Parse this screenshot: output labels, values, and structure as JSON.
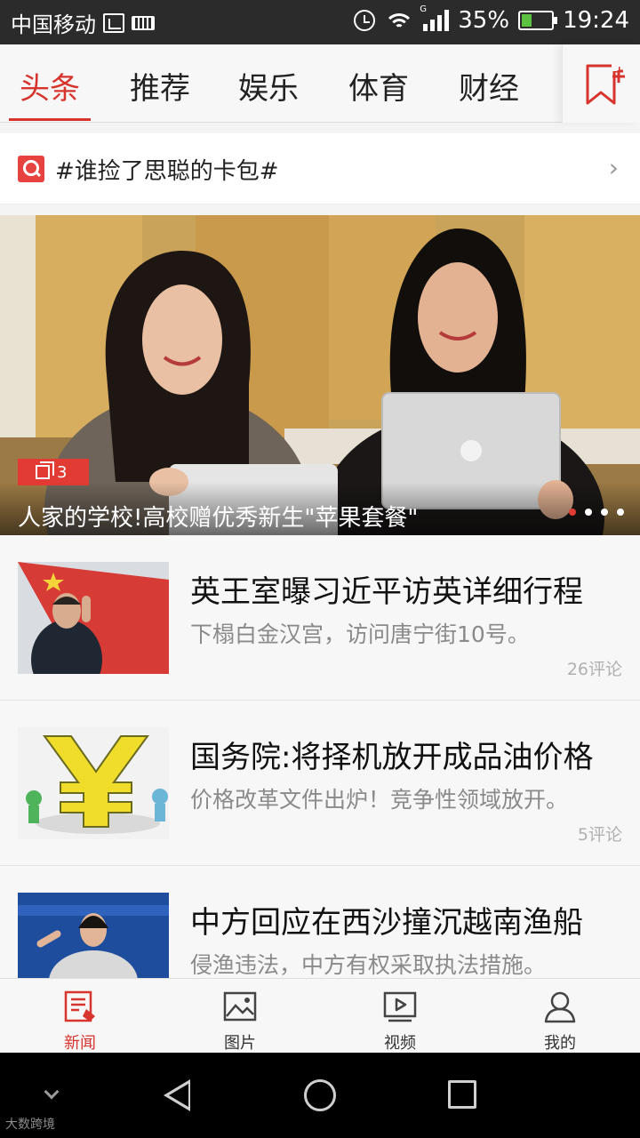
{
  "status_bar": {
    "carrier": "中国移动",
    "network_type": "G",
    "battery": "35%",
    "time": "19:24"
  },
  "tabs": {
    "items": [
      {
        "label": "头条",
        "active": true
      },
      {
        "label": "推荐",
        "active": false
      },
      {
        "label": "娱乐",
        "active": false
      },
      {
        "label": "体育",
        "active": false
      },
      {
        "label": "财经",
        "active": false
      }
    ],
    "add_icon": "bookmark-plus-icon"
  },
  "search": {
    "icon": "search-icon",
    "text": "#谁捡了思聪的卡包#",
    "arrow": "›"
  },
  "hero": {
    "gallery_count": "3",
    "title": "人家的学校!高校赠优秀新生\"苹果套餐\"",
    "dots_total": 4,
    "dots_active": 0
  },
  "news": [
    {
      "title": "英王室曝习近平访英详细行程",
      "desc": "下榻白金汉宫，访问唐宁街10号。",
      "comments": "26评论"
    },
    {
      "title": "国务院:将择机放开成品油价格",
      "desc": "价格改革文件出炉！竞争性领域放开。",
      "comments": "5评论"
    },
    {
      "title": "中方回应在西沙撞沉越南渔船",
      "desc": "侵渔违法，中方有权采取执法措施。",
      "comments": ""
    }
  ],
  "bottom_nav": [
    {
      "label": "新闻",
      "icon": "news-icon",
      "active": true
    },
    {
      "label": "图片",
      "icon": "picture-icon",
      "active": false
    },
    {
      "label": "视频",
      "icon": "video-icon",
      "active": false
    },
    {
      "label": "我的",
      "icon": "profile-icon",
      "active": false
    }
  ],
  "watermark": "大数跨境",
  "colors": {
    "accent": "#d6342c",
    "status_bar": "#2b2b2b",
    "page_bg": "#f7f7f7"
  }
}
